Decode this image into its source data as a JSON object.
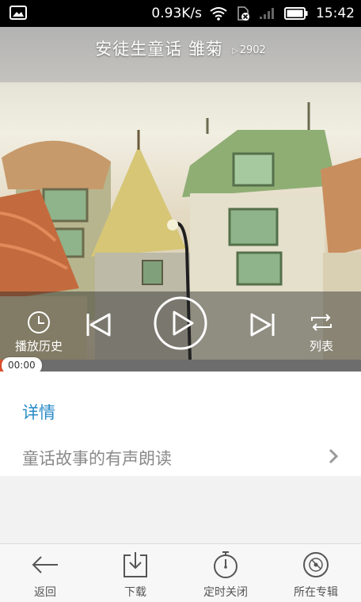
{
  "status_bar": {
    "speed": "0.93K/s",
    "time": "15:42"
  },
  "player": {
    "title": "安徒生童话 雏菊",
    "play_count": "2902",
    "history_label": "播放历史",
    "list_label": "列表",
    "current_time": "00:00",
    "progress_percent": 0
  },
  "details": {
    "heading": "详情",
    "description": "童话故事的有声朗读"
  },
  "bottom_nav": {
    "back": "返回",
    "download": "下载",
    "timer_close": "定时关闭",
    "album": "所在专辑"
  },
  "colors": {
    "accent_blue": "#2a8bc8",
    "progress": "#e2502c"
  }
}
